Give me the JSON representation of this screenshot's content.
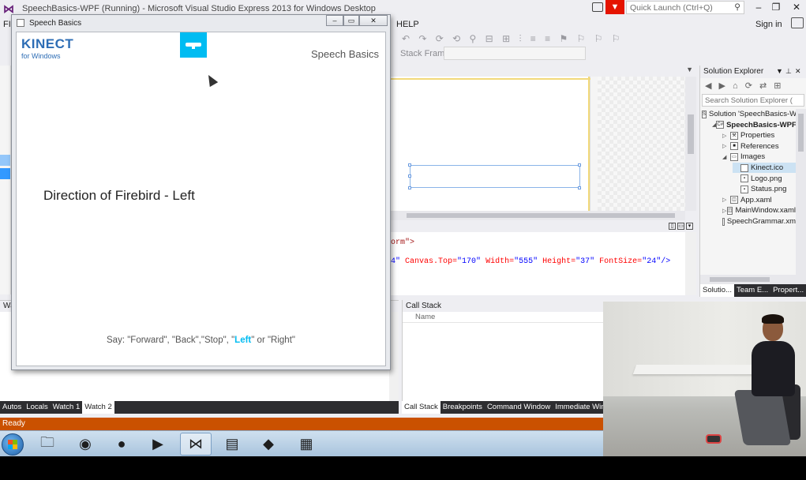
{
  "vs": {
    "title": "SpeechBasics-WPF (Running) - Microsoft Visual Studio Express 2013 for Windows Desktop",
    "quick_launch_placeholder": "Quick Launch (Ctrl+Q)",
    "menu_file": "FIL",
    "menu_help": "HELP",
    "sign_in": "Sign in",
    "stack_frame_label": "Stack Frame:",
    "toolbar_icons": "↶ ↷ ⟳ ⟲ ⚲ ⊟ ⊞ ⫶ ≡ ≡ ⚑ ⚐ ⚐ ⚐"
  },
  "xaml": {
    "line1": "orm\">",
    "line2_attr1_value": "4\"",
    "line2_canvas_top": "Canvas.Top=",
    "line2_canvas_top_val": "\"170\"",
    "line2_width": "Width=",
    "line2_width_val": "\"555\"",
    "line2_height": "Height=",
    "line2_height_val": "\"37\"",
    "line2_fontsize": "FontSize=",
    "line2_fontsize_val": "\"24\"",
    "line2_end": "/>"
  },
  "solution_explorer": {
    "title": "Solution Explorer",
    "search_placeholder": "Search Solution Explorer (",
    "items": [
      {
        "label": "Solution 'SpeechBasics-WI",
        "indent": 0,
        "arrow": "",
        "icon": "solution-icon",
        "bold": false
      },
      {
        "label": "SpeechBasics-WPF",
        "indent": 1,
        "arrow": "◢",
        "icon": "project-icon",
        "bold": true
      },
      {
        "label": "Properties",
        "indent": 2,
        "arrow": "▷",
        "icon": "wrench-icon",
        "bold": false
      },
      {
        "label": "References",
        "indent": 2,
        "arrow": "▷",
        "icon": "references-icon",
        "bold": false
      },
      {
        "label": "Images",
        "indent": 2,
        "arrow": "◢",
        "icon": "folder-icon",
        "bold": false
      },
      {
        "label": "Kinect.ico",
        "indent": 3,
        "arrow": "",
        "icon": "file-icon",
        "bold": false,
        "selected": true
      },
      {
        "label": "Logo.png",
        "indent": 3,
        "arrow": "",
        "icon": "image-icon",
        "bold": false
      },
      {
        "label": "Status.png",
        "indent": 3,
        "arrow": "",
        "icon": "image-icon",
        "bold": false
      },
      {
        "label": "App.xaml",
        "indent": 2,
        "arrow": "▷",
        "icon": "xaml-icon",
        "bold": false
      },
      {
        "label": "MainWindow.xaml",
        "indent": 2,
        "arrow": "▷",
        "icon": "xaml-icon",
        "bold": false
      },
      {
        "label": "SpeechGrammar.xm",
        "indent": 2,
        "arrow": "",
        "icon": "file-icon",
        "bold": false
      }
    ],
    "tabs": [
      "Solutio...",
      "Team E...",
      "Propert..."
    ]
  },
  "bottom_left": {
    "header": "Wa",
    "tabs": [
      "Autos",
      "Locals",
      "Watch 1",
      "Watch 2"
    ],
    "active_tab": "Watch 2"
  },
  "call_stack": {
    "title": "Call Stack",
    "column_name": "Name",
    "tabs": [
      "Call Stack",
      "Breakpoints",
      "Command Window",
      "Immediate Winc"
    ],
    "active_tab": "Call Stack"
  },
  "status": "Ready",
  "app": {
    "title": "Speech Basics",
    "logo_main": "KINECT",
    "logo_sub": "for Windows",
    "heading": "Speech Basics",
    "direction_text": "Direction of Firebird - Left",
    "say_prefix": "Say: \"Forward\", \"Back\",\"Stop\", \"",
    "say_highlight": "Left",
    "say_suffix": "\" or \"Right\""
  },
  "colors": {
    "status_bar": "#ca5100",
    "kinect_blue": "#00bcf2",
    "logo_blue": "#2d6db5"
  },
  "taskbar": [
    "windows-start-icon",
    "file-explorer-icon",
    "chrome-icon",
    "firefox-icon",
    "media-player-icon",
    "visual-studio-icon",
    "pdf-icon",
    "kinect-tool-icon",
    "document-icon"
  ]
}
